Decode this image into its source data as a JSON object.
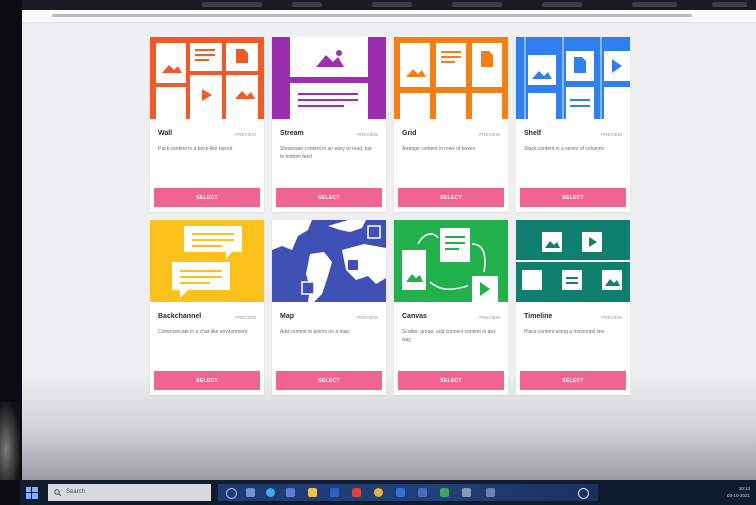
{
  "cards": [
    {
      "title": "Wall",
      "preview_label": "PREVIEW",
      "description": "Pack content in a brick-like layout",
      "select_label": "SELECT",
      "color": "#f05a28"
    },
    {
      "title": "Stream",
      "preview_label": "PREVIEW",
      "description": "Showcase content in an easy to read, top to bottom feed",
      "select_label": "SELECT",
      "color": "#9c2fae"
    },
    {
      "title": "Grid",
      "preview_label": "PREVIEW",
      "description": "Arrange content in rows of boxes",
      "select_label": "SELECT",
      "color": "#f57f17"
    },
    {
      "title": "Shelf",
      "preview_label": "PREVIEW",
      "description": "Stack content in a series of columns",
      "select_label": "SELECT",
      "color": "#2f80ed"
    },
    {
      "title": "Backchannel",
      "preview_label": "PREVIEW",
      "description": "Communicate in a chat-like environment",
      "select_label": "SELECT",
      "color": "#fcc21b"
    },
    {
      "title": "Map",
      "preview_label": "PREVIEW",
      "description": "Add content to points on a map",
      "select_label": "SELECT",
      "color": "#3f51b5"
    },
    {
      "title": "Canvas",
      "preview_label": "PREVIEW",
      "description": "Scatter, group, and connect content in any way",
      "select_label": "SELECT",
      "color": "#22b14c"
    },
    {
      "title": "Timeline",
      "preview_label": "PREVIEW",
      "description": "Place content along a horizontal line",
      "select_label": "SELECT",
      "color": "#0f7f6f"
    }
  ],
  "taskbar": {
    "search_placeholder": "Search",
    "tray_time": "10:13",
    "tray_date": "03-10-2021"
  },
  "accent_color": "#f06490"
}
